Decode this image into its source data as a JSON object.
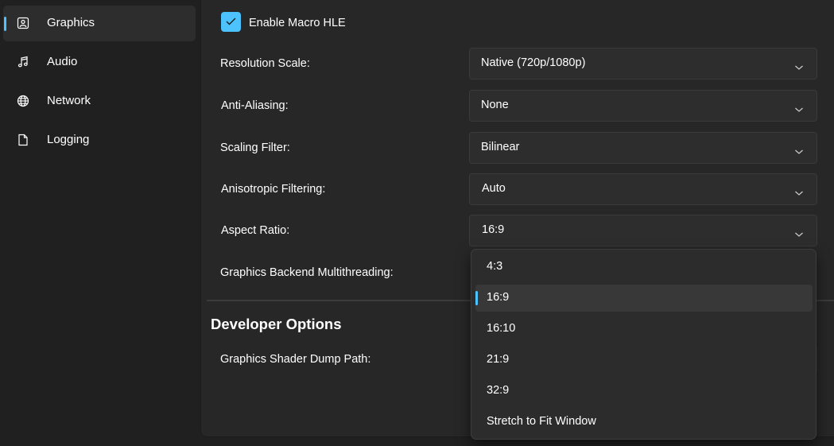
{
  "sidebar": {
    "items": [
      {
        "label": "Graphics",
        "icon": "image-icon",
        "selected": true
      },
      {
        "label": "Audio",
        "icon": "music-note-icon",
        "selected": false
      },
      {
        "label": "Network",
        "icon": "globe-icon",
        "selected": false
      },
      {
        "label": "Logging",
        "icon": "document-icon",
        "selected": false
      }
    ]
  },
  "graphics": {
    "macro_hle": {
      "label": "Enable Macro HLE",
      "checked": true
    },
    "resolution_scale": {
      "label": "Resolution Scale:",
      "value": "Native (720p/1080p)"
    },
    "anti_aliasing": {
      "label": "Anti-Aliasing:",
      "value": "None"
    },
    "scaling_filter": {
      "label": "Scaling Filter:",
      "value": "Bilinear"
    },
    "anisotropic_filtering": {
      "label": "Anisotropic Filtering:",
      "value": "Auto"
    },
    "aspect_ratio": {
      "label": "Aspect Ratio:",
      "value": "16:9",
      "options": [
        "4:3",
        "16:9",
        "16:10",
        "21:9",
        "32:9",
        "Stretch to Fit Window"
      ],
      "selected_index": 1
    },
    "backend_multithreading": {
      "label": "Graphics Backend Multithreading:"
    }
  },
  "developer": {
    "title": "Developer Options",
    "shader_dump_path": {
      "label": "Graphics Shader Dump Path:"
    }
  },
  "colors": {
    "accent": "#4cc2ff",
    "background": "#202020",
    "panel": "#272727",
    "control": "#2d2d2d"
  }
}
